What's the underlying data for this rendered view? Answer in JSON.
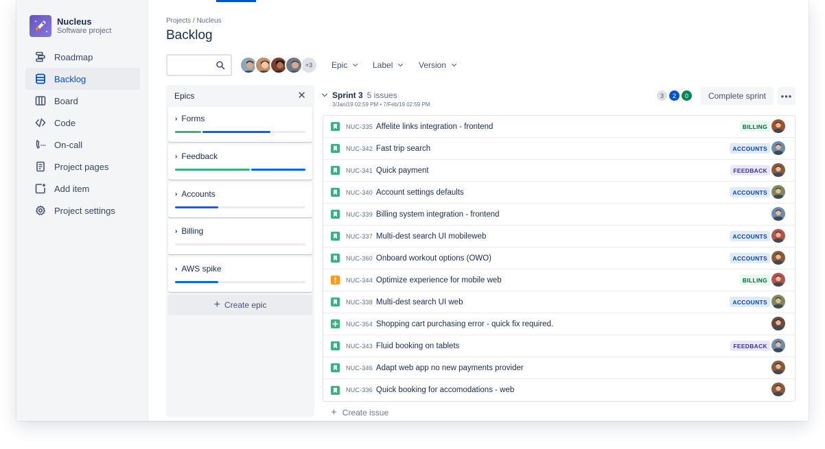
{
  "project": {
    "name": "Nucleus",
    "type": "Software project"
  },
  "sidebar": {
    "items": [
      {
        "label": "Roadmap",
        "icon": "roadmap-icon"
      },
      {
        "label": "Backlog",
        "icon": "backlog-icon",
        "active": true
      },
      {
        "label": "Board",
        "icon": "board-icon"
      },
      {
        "label": "Code",
        "icon": "code-icon"
      },
      {
        "label": "On-call",
        "icon": "on-call-icon"
      },
      {
        "label": "Project pages",
        "icon": "page-icon"
      },
      {
        "label": "Add item",
        "icon": "add-item-icon"
      },
      {
        "label": "Project settings",
        "icon": "gear-icon"
      }
    ]
  },
  "breadcrumb": "Projects / Nucleus",
  "page_title": "Backlog",
  "toolbar": {
    "avatars_more": "+3",
    "filters": {
      "epic": "Epic",
      "label": "Label",
      "version": "Version"
    }
  },
  "epics": {
    "title": "Epics",
    "items": [
      {
        "name": "Forms",
        "progress": [
          {
            "color": "#36b37e",
            "value": 0.2
          },
          {
            "color": "#0065ff",
            "value": 0.52
          }
        ]
      },
      {
        "name": "Feedback",
        "progress": [
          {
            "color": "#36b37e",
            "value": 0.58
          },
          {
            "color": "#0065ff",
            "value": 0.42
          }
        ]
      },
      {
        "name": "Accounts",
        "progress": [
          {
            "color": "#0065ff",
            "value": 0.33
          }
        ]
      },
      {
        "name": "Billing",
        "progress": []
      },
      {
        "name": "AWS spike",
        "progress": [
          {
            "color": "#0065ff",
            "value": 0.33
          }
        ]
      }
    ],
    "create_label": "Create epic"
  },
  "sprint": {
    "name": "Sprint 3",
    "count": "5 issues",
    "dates": "3/Jan/19 02:59 PM • 7/Feb/19 02:59 PM",
    "status_counts": {
      "todo": "3",
      "in_progress": "2",
      "done": "0"
    },
    "complete_label": "Complete sprint",
    "more_label": "•••"
  },
  "issues": [
    {
      "key": "NUC-335",
      "summary": "Affelite links integration - frontend",
      "type": "story",
      "label": "BILLING",
      "avatar": "#a0522d"
    },
    {
      "key": "NUC-342",
      "summary": "Fast trip search",
      "type": "story",
      "label": "ACCOUNTS",
      "avatar": "#6b8cae"
    },
    {
      "key": "NUC-341",
      "summary": "Quick payment",
      "type": "story",
      "label": "FEEDBACK",
      "avatar": "#8b5a3c"
    },
    {
      "key": "NUC-340",
      "summary": "Account settings defaults",
      "type": "story",
      "label": "ACCOUNTS",
      "avatar": "#7a8a5a"
    },
    {
      "key": "NUC-339",
      "summary": "Billing system integration - frontend",
      "type": "story",
      "label": "",
      "avatar": "#6b8cae"
    },
    {
      "key": "NUC-337",
      "summary": "Multi-dest search UI mobileweb",
      "type": "story",
      "label": "ACCOUNTS",
      "avatar": "#b5524a"
    },
    {
      "key": "NUC-360",
      "summary": "Onboard workout options (OWO)",
      "type": "story",
      "label": "ACCOUNTS",
      "avatar": "#8b5a3c"
    },
    {
      "key": "NUC-344",
      "summary": "Optimize experience for mobile web",
      "type": "bug",
      "label": "BILLING",
      "avatar": "#b5524a"
    },
    {
      "key": "NUC-338",
      "summary": "Multi-dest search UI web",
      "type": "story",
      "label": "ACCOUNTS",
      "avatar": "#7a8a5a"
    },
    {
      "key": "NUC-354",
      "summary": "Shopping cart purchasing error - quick fix required.",
      "type": "new",
      "label": "",
      "avatar": "#6e4a3a"
    },
    {
      "key": "NUC-343",
      "summary": "Fluid booking on tablets",
      "type": "story",
      "label": "FEEDBACK",
      "avatar": "#6b8cae"
    },
    {
      "key": "NUC-346",
      "summary": "Adapt web app no new payments provider",
      "type": "story",
      "label": "",
      "avatar": "#8b5a3c"
    },
    {
      "key": "NUC-336",
      "summary": "Quick booking for accomodations - web",
      "type": "story",
      "label": "",
      "avatar": "#8b5a3c"
    }
  ],
  "create_issue_label": "Create issue",
  "colors": {
    "accent": "#0052cc",
    "story": "#36b37e",
    "bug": "#ff991f",
    "billing": {
      "bg": "#e3fcef",
      "fg": "#006644"
    },
    "accounts": {
      "bg": "#deebff",
      "fg": "#0747a6"
    },
    "feedback": {
      "bg": "#eae6ff",
      "fg": "#403294"
    }
  }
}
